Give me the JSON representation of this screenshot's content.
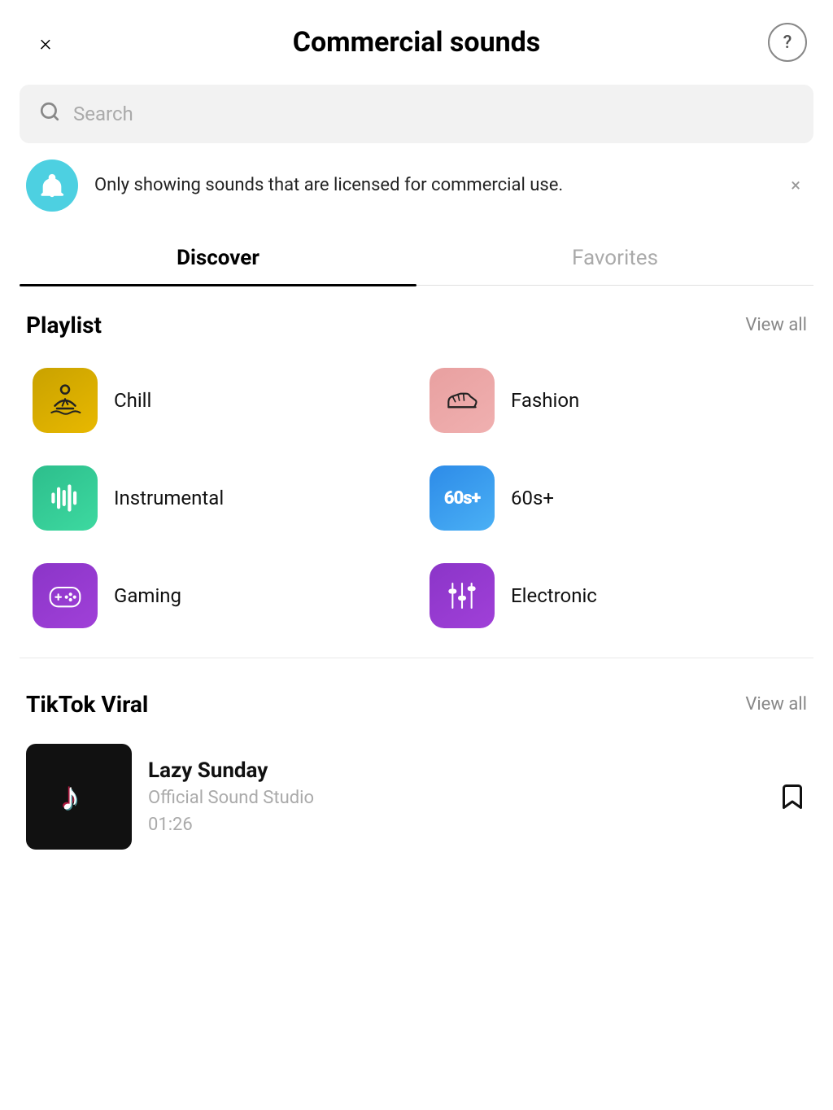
{
  "header": {
    "title": "Commercial sounds",
    "close_label": "×",
    "help_label": "?"
  },
  "search": {
    "placeholder": "Search"
  },
  "notice": {
    "text": "Only showing sounds that are licensed for commercial use."
  },
  "tabs": [
    {
      "id": "discover",
      "label": "Discover",
      "active": true
    },
    {
      "id": "favorites",
      "label": "Favorites",
      "active": false
    }
  ],
  "playlist_section": {
    "title": "Playlist",
    "view_all": "View all",
    "items": [
      {
        "id": "chill",
        "label": "Chill",
        "icon_class": "icon-chill"
      },
      {
        "id": "fashion",
        "label": "Fashion",
        "icon_class": "icon-fashion"
      },
      {
        "id": "instrumental",
        "label": "Instrumental",
        "icon_class": "icon-instrumental"
      },
      {
        "id": "60s",
        "label": "60s+",
        "icon_class": "icon-60s"
      },
      {
        "id": "gaming",
        "label": "Gaming",
        "icon_class": "icon-gaming"
      },
      {
        "id": "electronic",
        "label": "Electronic",
        "icon_class": "icon-electronic"
      }
    ]
  },
  "tiktok_viral_section": {
    "title": "TikTok Viral",
    "view_all": "View all",
    "items": [
      {
        "id": "lazy-sunday",
        "title": "Lazy Sunday",
        "artist": "Official Sound Studio",
        "duration": "01:26"
      }
    ]
  }
}
